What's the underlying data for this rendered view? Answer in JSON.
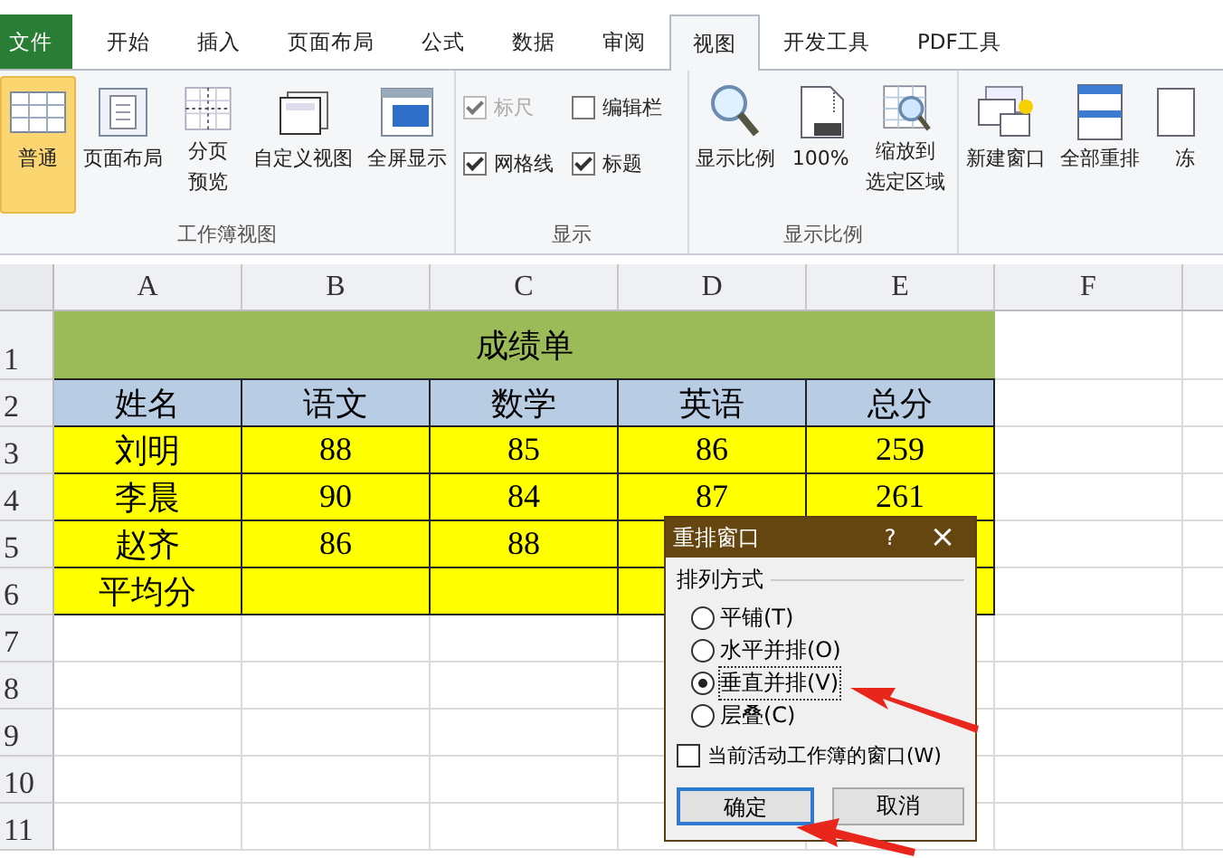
{
  "tabs": [
    {
      "label": "文件",
      "kind": "file",
      "selected": false
    },
    {
      "label": "开始",
      "kind": "tab",
      "selected": false
    },
    {
      "label": "插入",
      "kind": "tab",
      "selected": false
    },
    {
      "label": "页面布局",
      "kind": "tab",
      "selected": false
    },
    {
      "label": "公式",
      "kind": "tab",
      "selected": false
    },
    {
      "label": "数据",
      "kind": "tab",
      "selected": false
    },
    {
      "label": "审阅",
      "kind": "tab",
      "selected": false
    },
    {
      "label": "视图",
      "kind": "tab",
      "selected": true
    },
    {
      "label": "开发工具",
      "kind": "tab",
      "selected": false
    },
    {
      "label": "PDF工具",
      "kind": "tab",
      "selected": false
    }
  ],
  "ribbon": [
    {
      "label": "工作簿视图",
      "kind": "buttons",
      "items": [
        {
          "label": "普通",
          "selected": true
        },
        {
          "label": "页面布局",
          "selected": false
        },
        {
          "lines": [
            "分页",
            "预览"
          ],
          "selected": false
        },
        {
          "label": "自定义视图",
          "selected": false
        },
        {
          "label": "全屏显示",
          "selected": false
        }
      ]
    },
    {
      "label": "显示",
      "kind": "checks",
      "items": [
        {
          "label": "标尺",
          "checked": true,
          "disabled": true
        },
        {
          "label": "编辑栏",
          "checked": false,
          "disabled": false
        },
        {
          "label": "网格线",
          "checked": true,
          "disabled": false
        },
        {
          "label": "标题",
          "checked": true,
          "disabled": false
        }
      ]
    },
    {
      "label": "显示比例",
      "kind": "buttons",
      "items": [
        {
          "label": "显示比例",
          "selected": false
        },
        {
          "label": "100%",
          "selected": false
        },
        {
          "lines": [
            "缩放到",
            "选定区域"
          ],
          "selected": false
        }
      ]
    },
    {
      "kind": "buttons",
      "items": [
        {
          "label": "新建窗口",
          "selected": false
        },
        {
          "label": "全部重排",
          "selected": false
        },
        {
          "label": "冻",
          "selected": false
        }
      ]
    }
  ],
  "sheet": {
    "columns": [
      "A",
      "B",
      "C",
      "D",
      "E",
      "F"
    ],
    "row_numbers": [
      "1",
      "2",
      "3",
      "4",
      "5",
      "6",
      "7",
      "8",
      "9",
      "10",
      "11"
    ],
    "title": "成绩单",
    "rows": [
      {
        "kind": "header",
        "cells": [
          "姓名",
          "语文",
          "数学",
          "英语",
          "总分"
        ]
      },
      {
        "kind": "data",
        "cells": [
          "刘明",
          "88",
          "85",
          "86",
          "259"
        ]
      },
      {
        "kind": "data",
        "cells": [
          "李晨",
          "90",
          "84",
          "87",
          "261"
        ]
      },
      {
        "kind": "data",
        "cells": [
          "赵齐",
          "86",
          "88",
          null,
          null
        ]
      },
      {
        "kind": "data",
        "cells": [
          "平均分",
          null,
          null,
          null,
          null
        ]
      }
    ]
  },
  "dialog": {
    "title": "重排窗口",
    "help": "?",
    "close": "×",
    "group_label": "排列方式",
    "options": [
      {
        "label": "平铺(T)",
        "selected": false
      },
      {
        "label": "水平并排(O)",
        "selected": false
      },
      {
        "label": "垂直并排(V)",
        "selected": true
      },
      {
        "label": "层叠(C)",
        "selected": false
      }
    ],
    "checkbox": {
      "label": "当前活动工作簿的窗口(W)",
      "checked": false
    },
    "buttons": [
      {
        "label": "确定",
        "focused": true
      },
      {
        "label": "取消",
        "focused": false
      }
    ]
  }
}
